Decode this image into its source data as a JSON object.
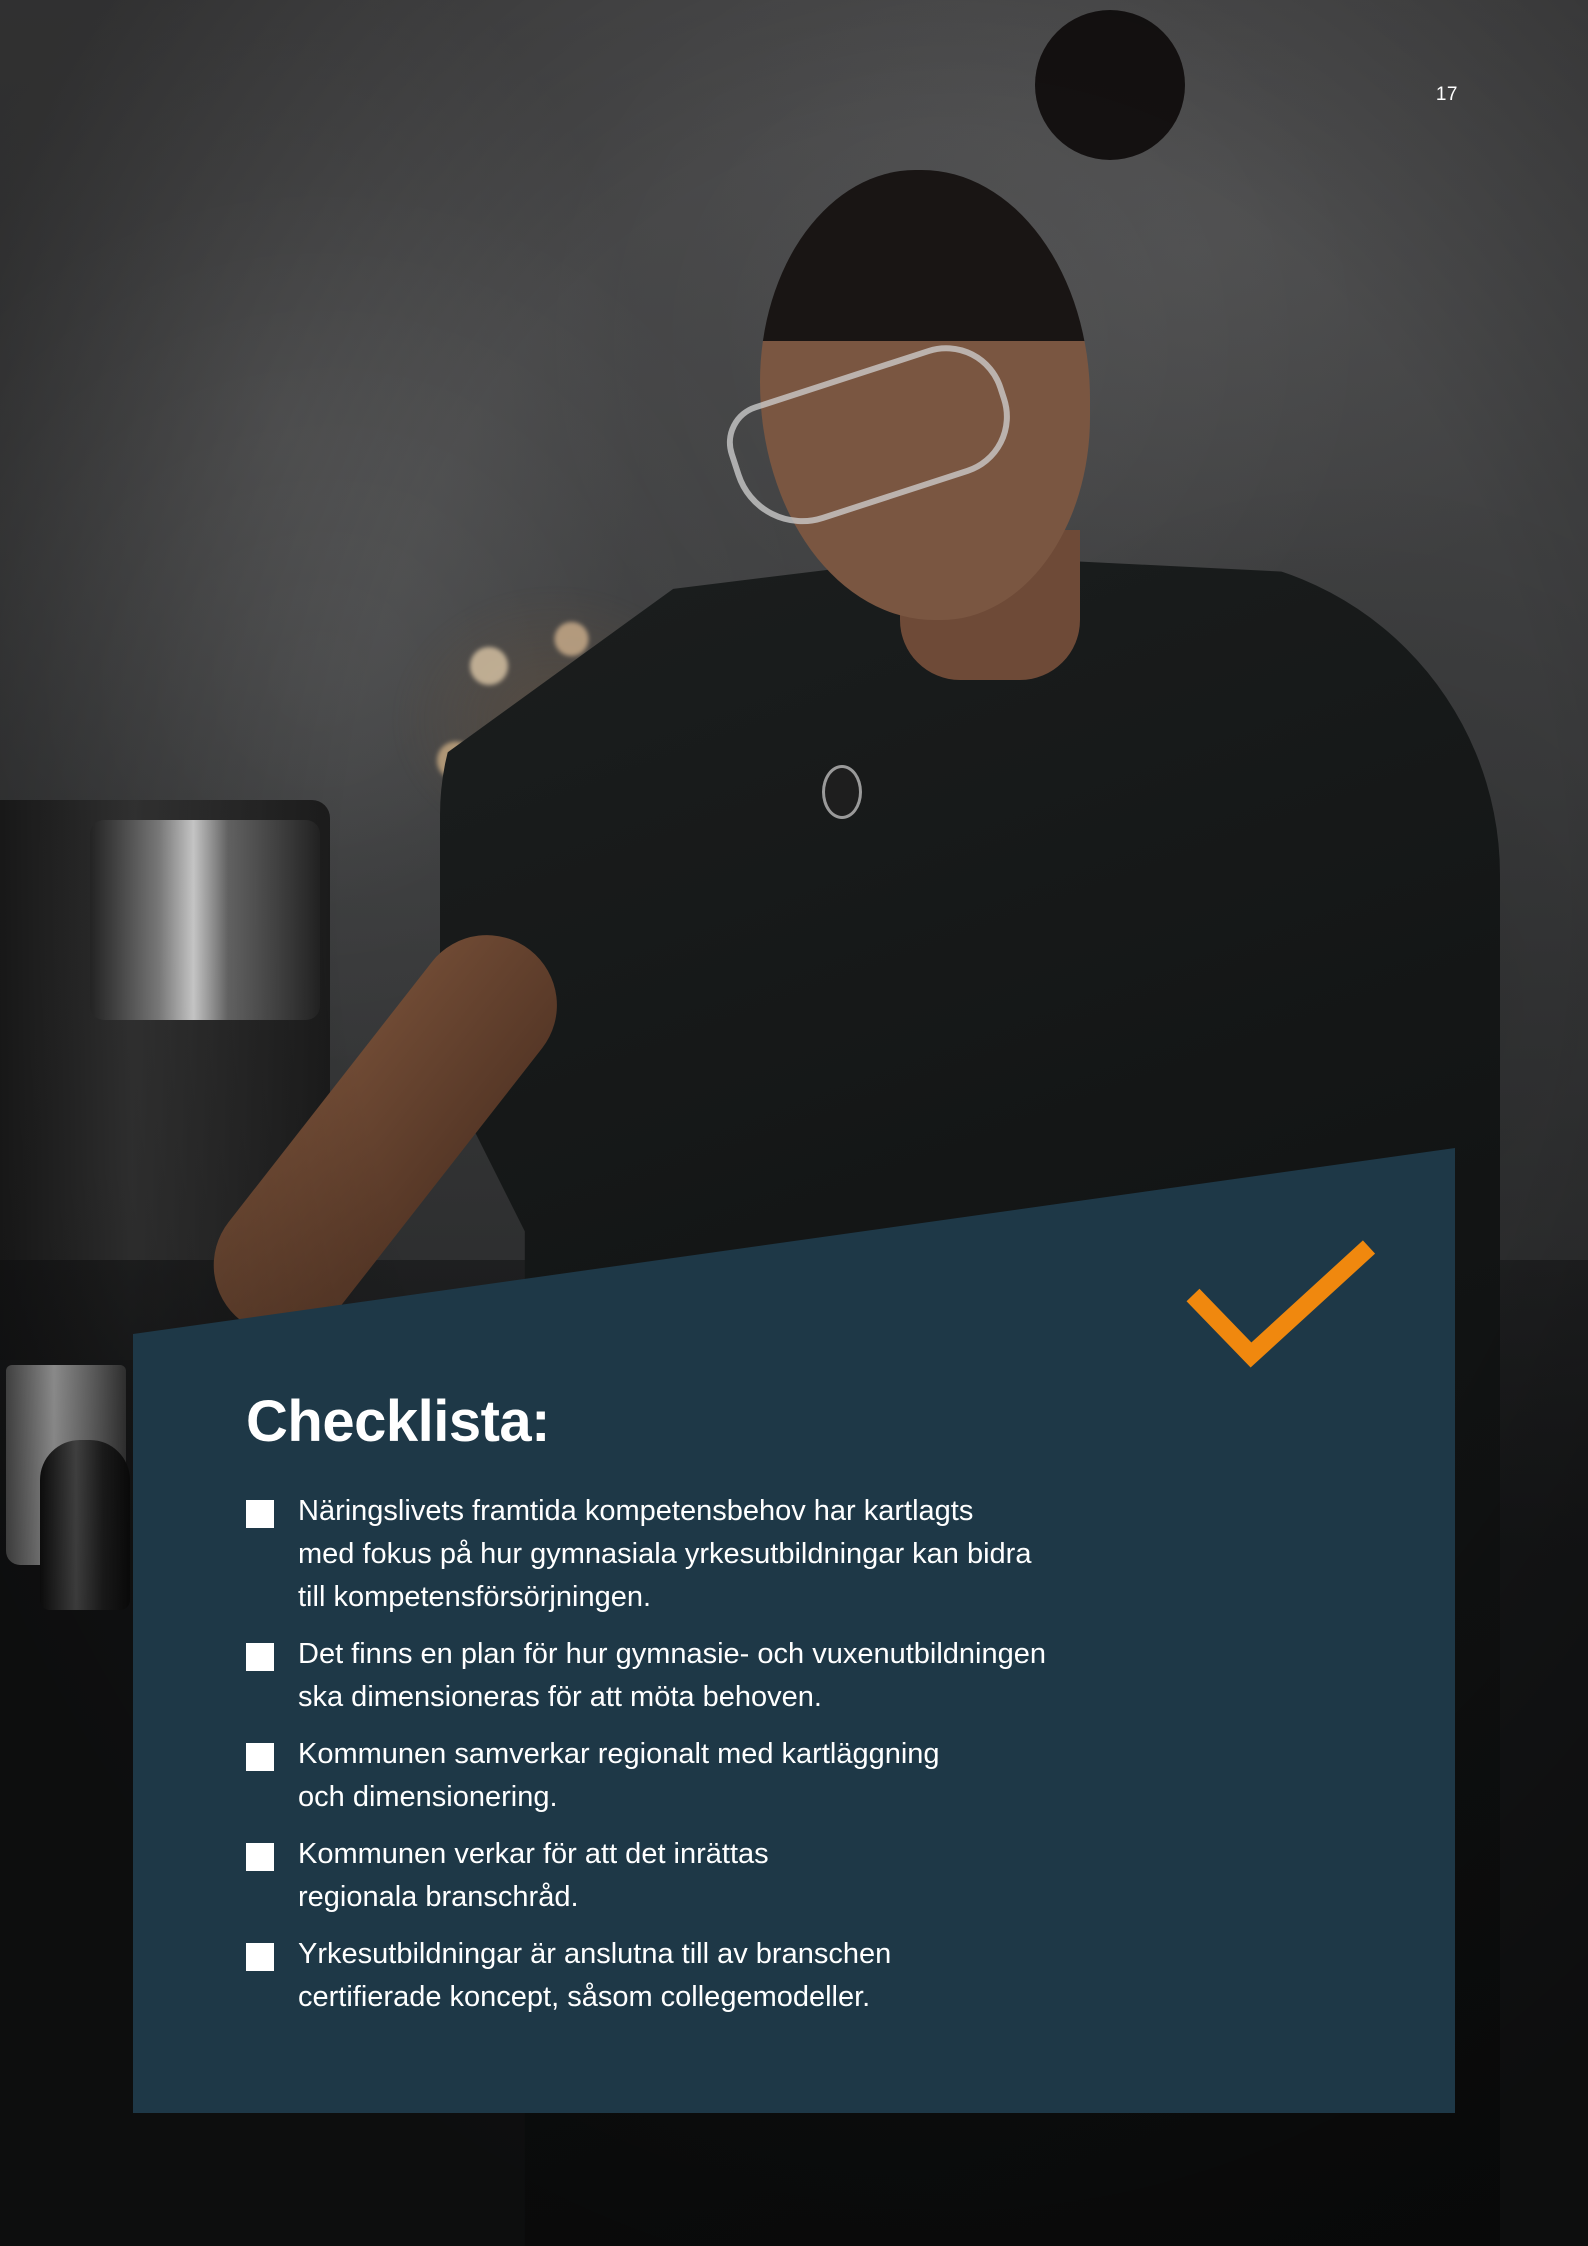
{
  "page": {
    "number": "17"
  },
  "photo": {
    "subject": "barista at espresso machine"
  },
  "checklist": {
    "title": "Checklista:",
    "accent_color": "#f0880e",
    "panel_color": "#1e3847",
    "items": [
      {
        "text": "Näringslivets framtida kompetensbehov har kartlagts\nmed fokus på hur gymnasiala yrkesutbildningar kan bidra\ntill kompetensförsörjningen."
      },
      {
        "text": "Det finns en plan för hur gymnasie- och vuxenutbildningen\nska dimensioneras för att möta behoven."
      },
      {
        "text": "Kommunen samverkar regionalt med kartläggning\noch dimensionering."
      },
      {
        "text": "Kommunen verkar för att det inrättas\nregionala branschråd."
      },
      {
        "text": "Yrkesutbildningar är anslutna till av branschen\ncertifierade koncept, såsom collegemodeller."
      }
    ]
  }
}
